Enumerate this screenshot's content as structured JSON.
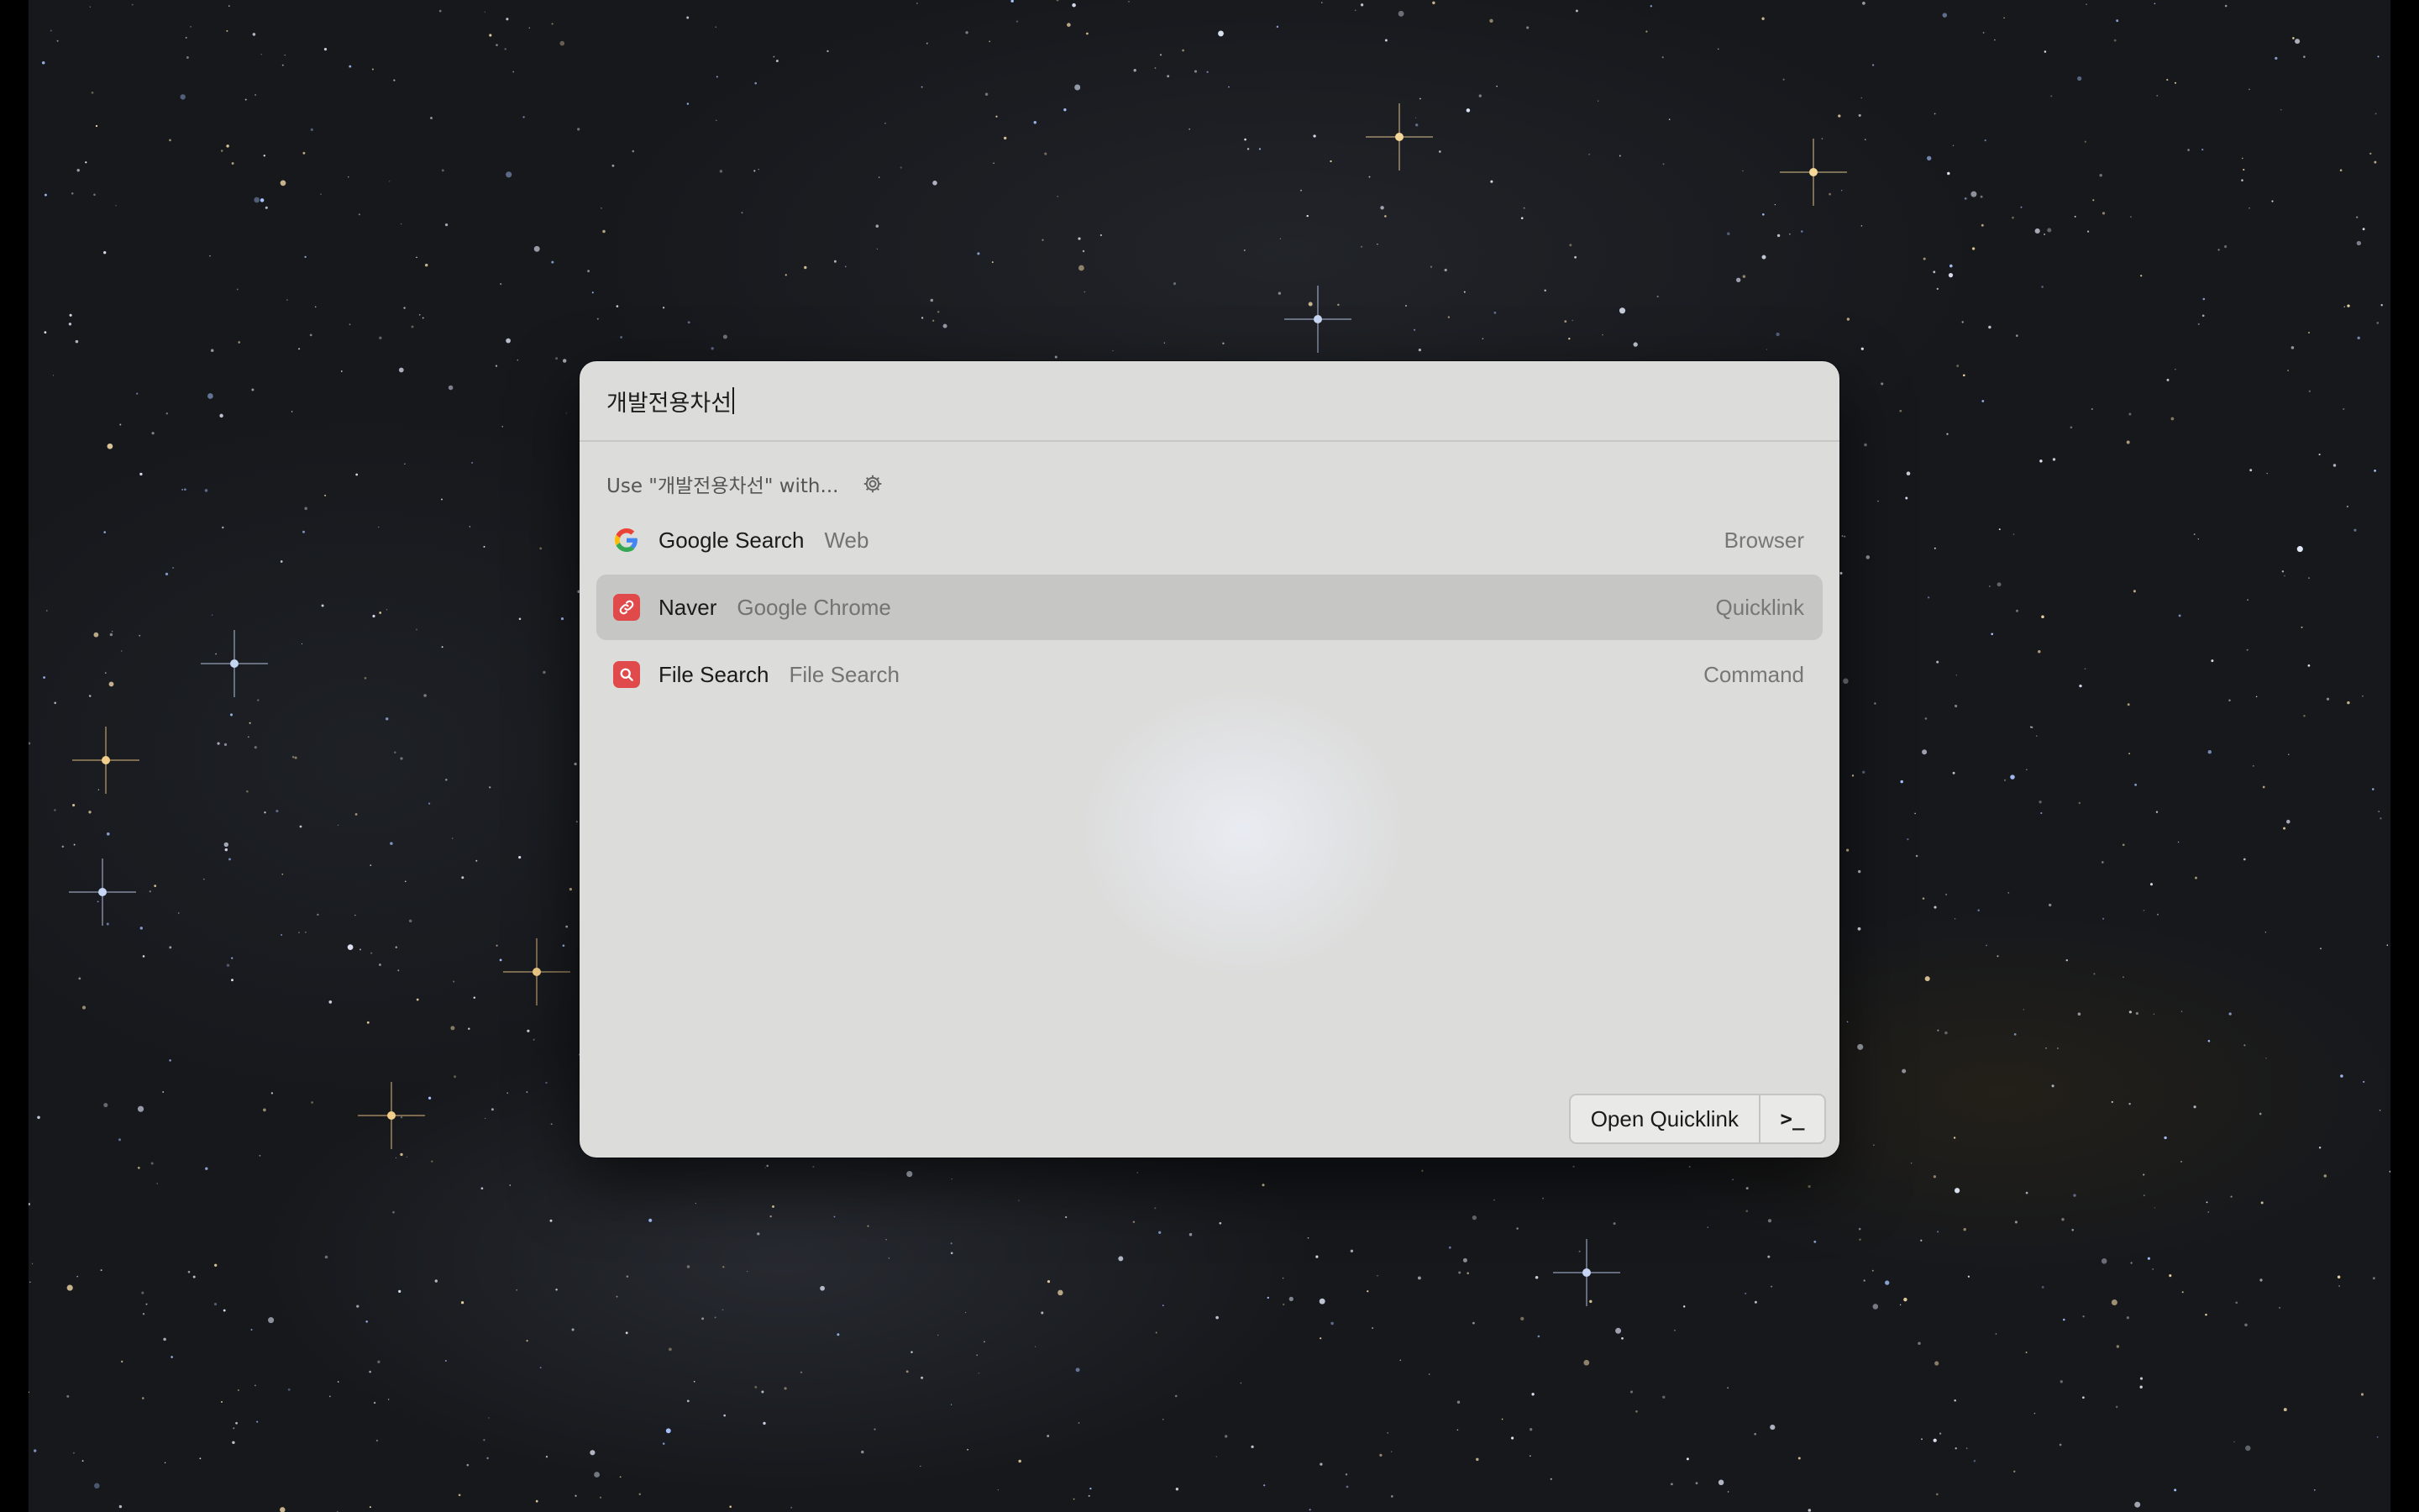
{
  "search": {
    "query": "개발전용차선"
  },
  "fallback": {
    "header": "Use \"개발전용차선\" with...",
    "settings_icon": "gear-icon"
  },
  "results": [
    {
      "title": "Google Search",
      "subtitle": "Web",
      "type": "Browser",
      "icon": "google-icon",
      "selected": false
    },
    {
      "title": "Naver",
      "subtitle": "Google Chrome",
      "type": "Quicklink",
      "icon": "link-icon",
      "selected": true
    },
    {
      "title": "File Search",
      "subtitle": "File Search",
      "type": "Command",
      "icon": "magnifier-icon",
      "selected": false
    }
  ],
  "actions": {
    "primary_label": "Open Quicklink",
    "more_label": ">_"
  },
  "colors": {
    "panel": "#dcdcdb",
    "selected_row": "#c6c6c5",
    "icon_red": "#e04a4a"
  }
}
